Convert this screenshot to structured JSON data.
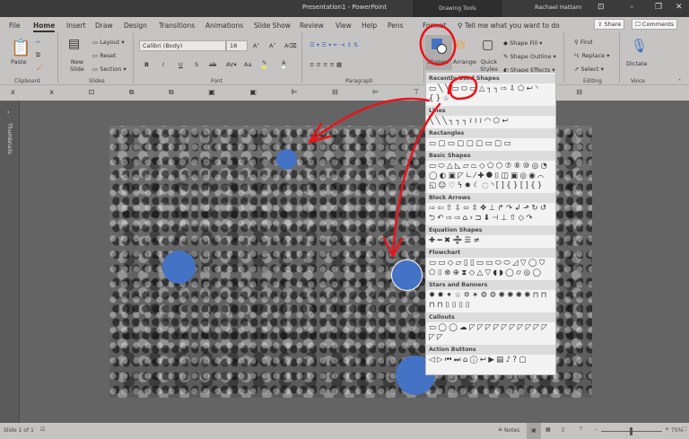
{
  "window": {
    "title": "Presentation1  -  PowerPoint",
    "context_tab": "Drawing Tools",
    "user": "Rachael Hattam"
  },
  "tabs": [
    "File",
    "Home",
    "Insert",
    "Draw",
    "Design",
    "Transitions",
    "Animations",
    "Slide Show",
    "Review",
    "View",
    "Help",
    "Pens",
    "Format"
  ],
  "tell_me": "Tell me what you want to do",
  "share": "Share",
  "comments": "Comments",
  "clipboard": {
    "paste": "Paste",
    "group": "Clipboard"
  },
  "slides": {
    "new_slide": "New Slide",
    "layout": "Layout",
    "reset": "Reset",
    "section": "Section",
    "group": "Slides"
  },
  "font": {
    "name": "Calibri (Body)",
    "size": "18",
    "group": "Font",
    "bold": "B",
    "italic": "I",
    "underline": "U",
    "shadow": "S",
    "strike": "ab",
    "case": "Aa"
  },
  "paragraph": {
    "group": "Paragraph"
  },
  "drawing": {
    "shapes": "Shapes",
    "arrange": "Arrange",
    "quick_styles": "Quick Styles",
    "fill": "Shape Fill",
    "outline": "Shape Outline",
    "effects": "Shape Effects"
  },
  "editing": {
    "find": "Find",
    "replace": "Replace",
    "select": "Select",
    "group": "Editing"
  },
  "voice": {
    "dictate": "Dictate",
    "group": "Voice"
  },
  "thumbnails": "Thumbnails",
  "status": {
    "slide": "Slide 1 of 1",
    "notes": "Notes",
    "zoom": "75%",
    "zoom_percent": 75
  },
  "accent": "#4472c4",
  "annotation_color": "#e8141c",
  "shapes_panel": [
    {
      "title": "Recently Used Shapes",
      "icons": "▭╲╲▭⬭▭△┐┐⇨⇩⬠↩◝{}☆"
    },
    {
      "title": "Lines",
      "icons": "╲╲╲┐┐┐≀≀≀◠⬠↩"
    },
    {
      "title": "Rectangles",
      "icons": "▭▢▭▢▢▢▭▢▭"
    },
    {
      "title": "Basic Shapes",
      "icons": "▭⬭△◺▱⏢◇⬠⬡⑦⑧⑩◎◔◯◐▣◸∟⁄✚⯃⌷◫▣◎◉⌒◱☺♡ϟ✹☾◌◝[]{}[]{}"
    },
    {
      "title": "Block Arrows",
      "icons": "⇨⇦⇧⇩⬄⇳✥⊥↱↷↲⬏↻↺⮌↶⇨⇨⌂›⊐⬇⊣⊥⇧◇↷"
    },
    {
      "title": "Equation Shapes",
      "icons": "✚━✖➗☰≠"
    },
    {
      "title": "Flowchart",
      "icons": "▭▭◇▱▯▯▭▭⬭⬭◿▽◯⛉⬠⌷⊗⊕⧗◇△▽◖◗◯⌭◎◯"
    },
    {
      "title": "Stars and Banners",
      "icons": "✹✹✦☆✡✶⚙⚙✺✺✺✺⊓⊓⊓⊓⌷⌷⌷⌷"
    },
    {
      "title": "Callouts",
      "icons": "▭◯◯☁◸◸◸◸◸◸◸◸◸◸◸◸"
    },
    {
      "title": "Action Buttons",
      "icons": "◁▷⏮⏭⌂ⓘ↩▶▤♪?▢"
    }
  ]
}
